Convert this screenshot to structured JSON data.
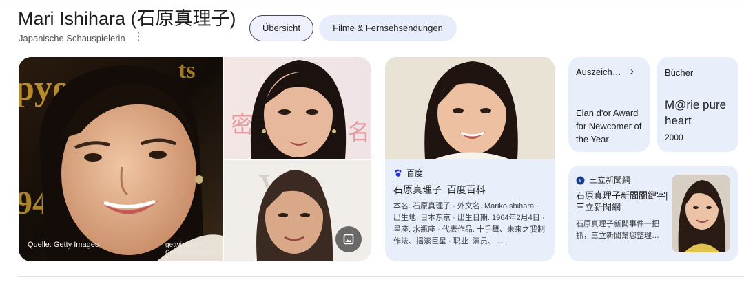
{
  "header": {
    "title": "Mari Ishihara (石原真理子)",
    "subtitle": "Japanische Schauspielerin",
    "more_icon": "more-vert-icon"
  },
  "tabs": [
    {
      "label": "Übersicht",
      "selected": true
    },
    {
      "label": "Filme & Fernsehsendungen",
      "selected": false
    }
  ],
  "images": {
    "main": {
      "watermark_brand": "gettyimages",
      "watermark_credit": "Credit: Bloomberg",
      "source_label": "Quelle: Getty Images"
    },
    "more_images_icon": "image-gallery-icon"
  },
  "cards": {
    "baidu": {
      "source": "百度",
      "source_icon": "baidu-paw-icon",
      "headline": "石原真理子_百度百科",
      "snippet": "本名. 石原真理子 · 外文名. MarikoIshihara · 出生地. 日本东京 · 出生日期. 1964年2月4日 · 星座. 水瓶座 · 代表作品. 十手舞、未来之我制作法、摇滚巨星 · 职业. 演员、 ..."
    },
    "award": {
      "label": "Auszeich…",
      "chevron_icon": "chevron-right-icon",
      "value": "Elan d'or Award for Newcomer of the Year"
    },
    "books": {
      "label": "Bücher",
      "value": "M@rie pure heart",
      "year": "2000"
    },
    "news": {
      "source": "三立新聞網",
      "source_icon": "setn-logo-icon",
      "headline": "石原真理子新聞關鍵字| 三立新聞網",
      "snippet": "石原真理子新聞事件一把抓，三立新聞幫您整理…"
    }
  },
  "colors": {
    "chip_selected_bg": "#eef1fb",
    "chip_bg": "#e8edfb",
    "card_bg": "#e9eefb",
    "text": "#1f1f1f",
    "muted_text": "#4d5156"
  }
}
